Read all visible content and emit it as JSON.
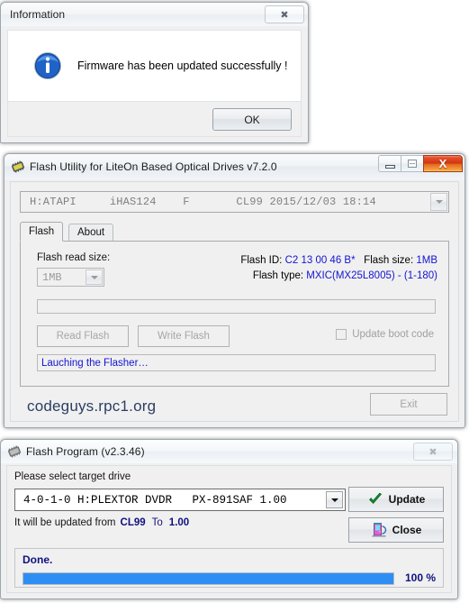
{
  "info_dialog": {
    "title": "Information",
    "message": "Firmware has been updated successfully !",
    "ok_label": "OK",
    "close_glyph": "✖",
    "icon": "information-icon"
  },
  "flash_utility": {
    "title": "Flash Utility for LiteOn Based Optical Drives v7.2.0",
    "icon": "chip-icon",
    "window_buttons": {
      "minimize": "minimize-icon",
      "maximize": "maximize-icon",
      "close": "X"
    },
    "drive_combo": {
      "value": "H:ATAPI     iHAS124    F       CL99 2015/12/03 18:14"
    },
    "tabs": [
      {
        "label": "Flash",
        "selected": true
      },
      {
        "label": "About",
        "selected": false
      }
    ],
    "flash_read_size_label": "Flash read size:",
    "flash_read_size_value": "1MB",
    "flash_id_label": "Flash ID:",
    "flash_id_value": "C2 13 00 46 B*",
    "flash_size_label": "Flash size:",
    "flash_size_value": "1MB",
    "flash_type_label": "Flash type:",
    "flash_type_value": "MXIC(MX25L8005) - (1-180)",
    "read_flash_label": "Read Flash",
    "write_flash_label": "Write Flash",
    "update_boot_code_label": "Update boot code",
    "update_boot_code_checked": false,
    "status_text": "Lauching the Flasher…",
    "watermark": "codeguys.rpc1.org",
    "exit_label": "Exit"
  },
  "flash_program": {
    "title": "Flash Program (v2.3.46)",
    "icon": "chip-icon",
    "close_glyph": "✖",
    "select_drive_label": "Please select target drive",
    "drive_value": "4-0-1-0 H:PLEXTOR DVDR   PX-891SAF 1.00",
    "update_from_prefix": "It will be updated from",
    "update_from_version": "CL99",
    "update_to_word": "To",
    "update_to_version": "1.00",
    "update_label": "Update",
    "update_icon": "green-check-icon",
    "close_label": "Close",
    "close_icon": "exit-door-icon",
    "progress_status": "Done.",
    "progress_percent_label": "100 %",
    "progress_percent": 100,
    "progress_color": "#2f8ef4"
  }
}
